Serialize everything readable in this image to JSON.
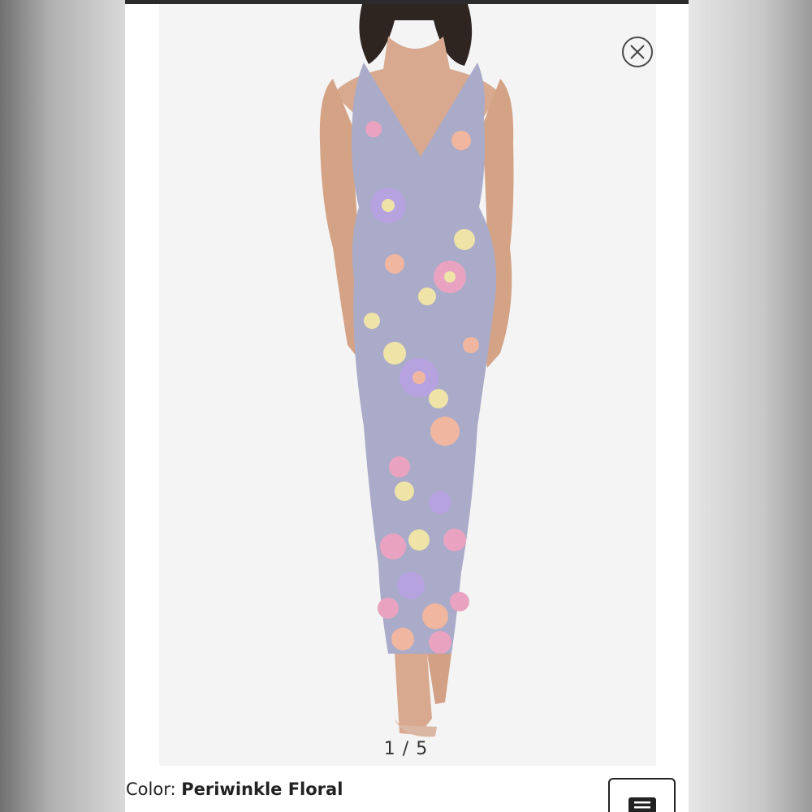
{
  "viewer": {
    "pager": "1 / 5",
    "close_icon": "close-circle-icon"
  },
  "product": {
    "color_label": "Color:",
    "color_value": "Periwinkle Floral"
  },
  "menu": {
    "icon": "menu-icon"
  },
  "colors": {
    "dress_base": "#a9abc9",
    "flower_pink": "#e9a3c0",
    "flower_lavender": "#b7a2e0",
    "flower_peach": "#f0b6a0",
    "flower_yellow": "#efe3a8"
  }
}
